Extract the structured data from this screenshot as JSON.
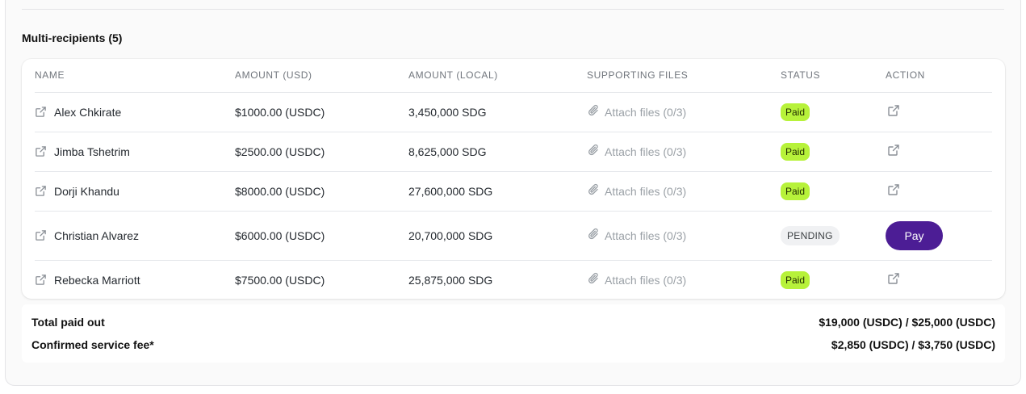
{
  "section": {
    "title": "Multi-recipients (5)"
  },
  "table": {
    "headers": [
      "NAME",
      "AMOUNT (USD)",
      "AMOUNT (LOCAL)",
      "SUPPORTING FILES",
      "STATUS",
      "ACTION"
    ],
    "rows": [
      {
        "name": "Alex Chkirate",
        "amount_usd": "$1000.00 (USDC)",
        "amount_local": "3,450,000 SDG",
        "files": "Attach files (0/3)",
        "status": "Paid"
      },
      {
        "name": "Jimba Tshetrim",
        "amount_usd": "$2500.00 (USDC)",
        "amount_local": "8,625,000 SDG",
        "files": "Attach files (0/3)",
        "status": "Paid"
      },
      {
        "name": "Dorji Khandu",
        "amount_usd": "$8000.00 (USDC)",
        "amount_local": "27,600,000 SDG",
        "files": "Attach files (0/3)",
        "status": "Paid"
      },
      {
        "name": "Christian Alvarez",
        "amount_usd": "$6000.00 (USDC)",
        "amount_local": "20,700,000 SDG",
        "files": "Attach files (0/3)",
        "status": "PENDING",
        "action_label": "Pay"
      },
      {
        "name": "Rebecka Marriott",
        "amount_usd": "$7500.00 (USDC)",
        "amount_local": "25,875,000 SDG",
        "files": "Attach files (0/3)",
        "status": "Paid"
      }
    ]
  },
  "totals": {
    "paid_label": "Total paid out",
    "paid_value": "$19,000 (USDC) / $25,000 (USDC)",
    "fee_label": "Confirmed service fee*",
    "fee_value": "$2,850 (USDC) / $3,750 (USDC)"
  },
  "colors": {
    "paid_badge": "#b7f23a",
    "pay_button": "#4c1d95",
    "pending_badge": "#f0f1f3"
  },
  "icons": {
    "row_link": "external-link-icon",
    "attach": "paperclip-icon",
    "action": "external-link-icon"
  }
}
